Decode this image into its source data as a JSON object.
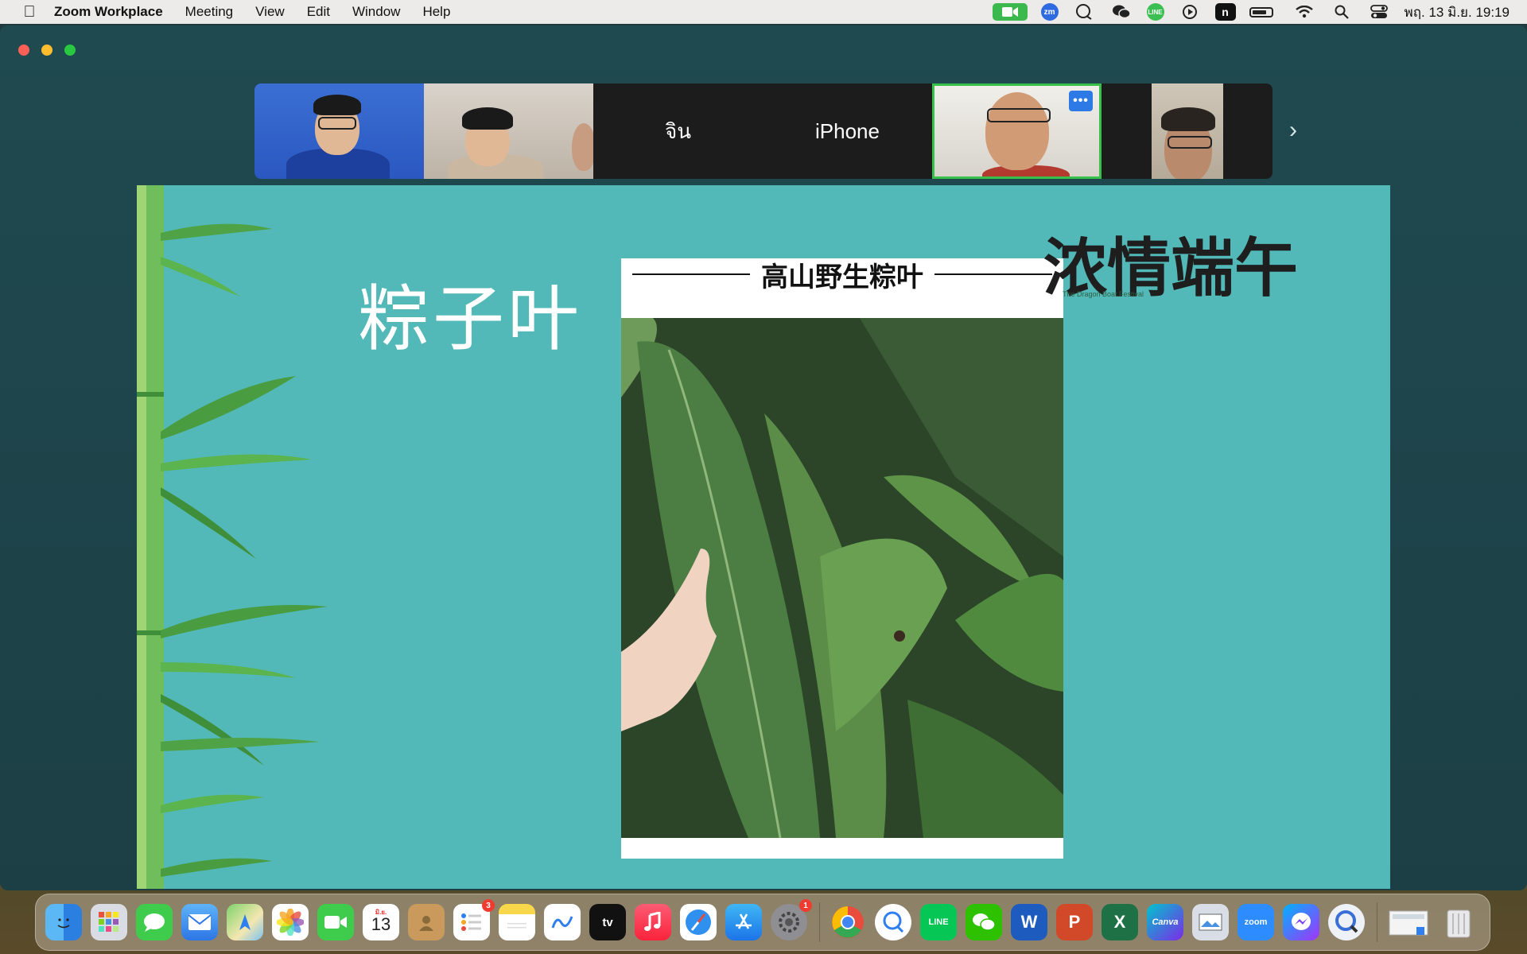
{
  "menubar": {
    "app_name": "Zoom Workplace",
    "menus": [
      "Meeting",
      "View",
      "Edit",
      "Window",
      "Help"
    ],
    "clock": "พฤ. 13 มิ.ย.  19:19",
    "tray_icons": [
      "zoom-camera-icon",
      "zoom-mini-icon",
      "chat-bubble-icon",
      "wechat-icon",
      "line-icon",
      "play-icon",
      "n-app-icon",
      "battery-icon",
      "wifi-icon",
      "search-icon",
      "control-center-icon"
    ]
  },
  "gallery": {
    "participants": [
      {
        "name": ""
      },
      {
        "name": ""
      },
      {
        "name": "จิน"
      },
      {
        "name": "iPhone"
      },
      {
        "name": ""
      },
      {
        "name": ""
      }
    ],
    "more_label": "•••",
    "next_label": "›"
  },
  "slide": {
    "title": "粽子叶",
    "photo_caption": "高山野生粽叶",
    "logo_text": "浓情端午",
    "logo_subtitle": "The Dragon Boat Festival"
  },
  "dock": {
    "calendar_month": "มิ.ย.",
    "calendar_day": "13",
    "reminders_badge": "3",
    "settings_badge": "1",
    "apps": [
      "Finder",
      "Launchpad",
      "Messages",
      "Mail",
      "Maps",
      "Photos",
      "FaceTime",
      "Calendar",
      "Contacts",
      "Reminders",
      "Notes",
      "Freeform",
      "TV",
      "Music",
      "Safari",
      "App Store",
      "System Settings",
      "Chrome",
      "QuickTime",
      "LINE",
      "WeChat",
      "Word",
      "PowerPoint",
      "Excel",
      "Canva",
      "Preview",
      "Zoom",
      "Messenger",
      "Screen Sharing",
      "Downloads",
      "Trash"
    ],
    "tv_label": "tv",
    "line_label": "LINE",
    "canva_label": "Canva",
    "zoom_label": "zoom"
  }
}
